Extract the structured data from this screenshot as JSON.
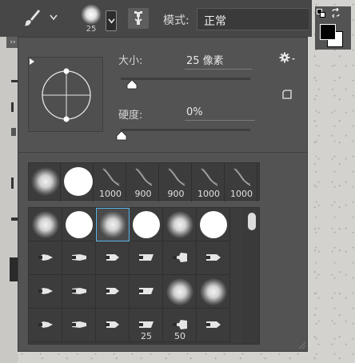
{
  "options_bar": {
    "preset_size": "25",
    "mode_label": "模式:",
    "mode_value": "正常"
  },
  "panel": {
    "size_label": "大小:",
    "size_value": "25 像素",
    "size_fraction": 0.08,
    "hardness_label": "硬度:",
    "hardness_value": "0%",
    "hardness_fraction": 0.0
  },
  "recent_brushes": [
    {
      "kind": "soft",
      "label": ""
    },
    {
      "kind": "hard",
      "label": ""
    },
    {
      "kind": "stroke",
      "label": "1000"
    },
    {
      "kind": "stroke",
      "label": "900"
    },
    {
      "kind": "stroke",
      "label": "900"
    },
    {
      "kind": "stroke",
      "label": "1000"
    },
    {
      "kind": "stroke",
      "label": "1000"
    }
  ],
  "brush_grid": [
    [
      {
        "kind": "soft",
        "label": ""
      },
      {
        "kind": "hard",
        "label": ""
      },
      {
        "kind": "soft",
        "label": "",
        "selected": true
      },
      {
        "kind": "hard",
        "label": ""
      },
      {
        "kind": "soft",
        "label": ""
      },
      {
        "kind": "hard",
        "label": ""
      }
    ],
    [
      {
        "kind": "tip",
        "label": ""
      },
      {
        "kind": "tip",
        "label": ""
      },
      {
        "kind": "tip",
        "label": ""
      },
      {
        "kind": "tip",
        "label": ""
      },
      {
        "kind": "tip",
        "label": ""
      },
      {
        "kind": "tip",
        "label": ""
      }
    ],
    [
      {
        "kind": "tip",
        "label": ""
      },
      {
        "kind": "tip",
        "label": ""
      },
      {
        "kind": "tip",
        "label": ""
      },
      {
        "kind": "tip",
        "label": ""
      },
      {
        "kind": "soft",
        "label": ""
      },
      {
        "kind": "soft",
        "label": ""
      }
    ],
    [
      {
        "kind": "tip",
        "label": ""
      },
      {
        "kind": "tip",
        "label": ""
      },
      {
        "kind": "tip",
        "label": ""
      },
      {
        "kind": "tip",
        "label": "25"
      },
      {
        "kind": "tip",
        "label": "50"
      },
      {
        "kind": "tip",
        "label": ""
      }
    ]
  ],
  "colors": {
    "foreground": "#000000",
    "background": "#ffffff",
    "selection_outline": "#5ab3e8",
    "panel_bg": "#535353"
  },
  "icons": {
    "tool": "paintbrush-icon",
    "toggle": "brush-settings-panel-icon",
    "menu": "gear-icon",
    "new": "new-preset-icon"
  }
}
